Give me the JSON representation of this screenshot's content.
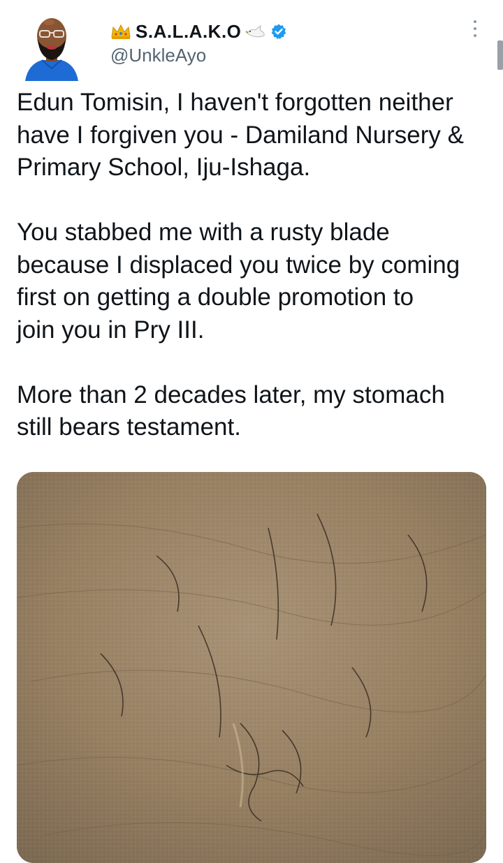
{
  "tweet": {
    "author": {
      "display_name": "S.A.L.A.K.O",
      "handle": "@UnkleAyo",
      "verified": true,
      "leading_emoji": "crown-emoji",
      "trailing_emoji": "dove-emoji"
    },
    "text_paragraphs": [
      [
        "Edun Tomisin, I haven't forgotten neither",
        "have I forgiven you - Damiland Nursery &",
        "Primary School, Iju-Ishaga."
      ],
      [
        "You stabbed me with a rusty blade",
        "because I displaced you twice by coming",
        "first on getting a double promotion to",
        "join you in Pry III."
      ],
      [
        "More than 2 decades later, my stomach",
        "still bears testament."
      ]
    ],
    "media": {
      "description_icon": "skin-photo",
      "type": "image"
    }
  },
  "colors": {
    "text_primary": "#0f1419",
    "text_secondary": "#536471",
    "verified_blue": "#1d9bf0",
    "crown_gold": "#f2b705"
  }
}
